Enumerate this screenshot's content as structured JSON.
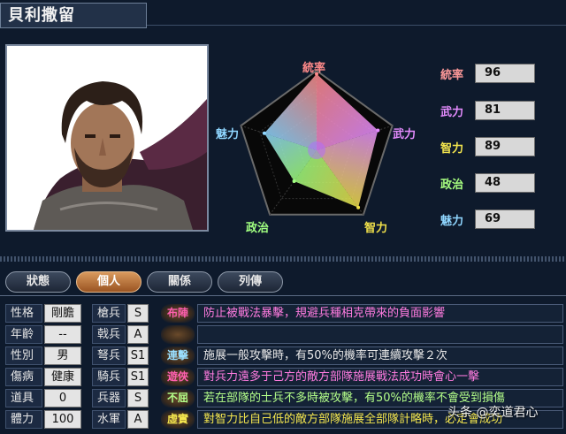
{
  "title": "貝利撒留",
  "radar": {
    "axes": [
      "統率",
      "武力",
      "智力",
      "政治",
      "魅力"
    ],
    "axis_colors": [
      "#ff8a8a",
      "#e58cff",
      "#f0e04a",
      "#a0ff80",
      "#8fd6ff"
    ],
    "values": [
      96,
      81,
      89,
      48,
      69
    ]
  },
  "stats": [
    {
      "label": "統率",
      "value": "96",
      "color": "#ff9a9a"
    },
    {
      "label": "武力",
      "value": "81",
      "color": "#e58cff"
    },
    {
      "label": "智力",
      "value": "89",
      "color": "#f4e64e"
    },
    {
      "label": "政治",
      "value": "48",
      "color": "#a8ff80"
    },
    {
      "label": "魅力",
      "value": "69",
      "color": "#8fd6ff"
    }
  ],
  "tabs": [
    "狀態",
    "個人",
    "關係",
    "列傳"
  ],
  "profile": [
    {
      "label": "性格",
      "value": "剛膽"
    },
    {
      "label": "年齡",
      "value": "--"
    },
    {
      "label": "性別",
      "value": "男"
    },
    {
      "label": "傷病",
      "value": "健康"
    },
    {
      "label": "道具",
      "value": "0"
    },
    {
      "label": "體力",
      "value": "100"
    }
  ],
  "aptitudes": [
    {
      "label": "槍兵",
      "value": "S"
    },
    {
      "label": "戟兵",
      "value": "A"
    },
    {
      "label": "弩兵",
      "value": "S1"
    },
    {
      "label": "騎兵",
      "value": "S1"
    },
    {
      "label": "兵器",
      "value": "S"
    },
    {
      "label": "水軍",
      "value": "A"
    }
  ],
  "skills": [
    {
      "name": "布陣",
      "name_color": "#ff5fb0",
      "desc": "防止被戰法暴擊，規避兵種相克帶來的負面影響",
      "desc_color": "#ff7ce0"
    },
    {
      "name": "",
      "name_color": "#e0a060",
      "desc": "",
      "desc_color": "#ffffff"
    },
    {
      "name": "連擊",
      "name_color": "#9adfff",
      "desc": "施展一般攻擊時，有50%的機率可連續攻擊２次",
      "desc_color": "#e8e8e8"
    },
    {
      "name": "遊俠",
      "name_color": "#ff5fb0",
      "desc": "對兵力遠多于己方的敵方部隊施展戰法成功時會心一擊",
      "desc_color": "#ff7ce0"
    },
    {
      "name": "不屈",
      "name_color": "#b4ff8a",
      "desc": "若在部隊的士兵不多時被攻擊，有50%的機率不會受到損傷",
      "desc_color": "#b4ff8a"
    },
    {
      "name": "虛實",
      "name_color": "#f4e64e",
      "desc": "對智力比自己低的敵方部隊施展全部隊計略時，必定會成功",
      "desc_color": "#f4e64e"
    }
  ],
  "watermark": "头条 @奕道君心"
}
